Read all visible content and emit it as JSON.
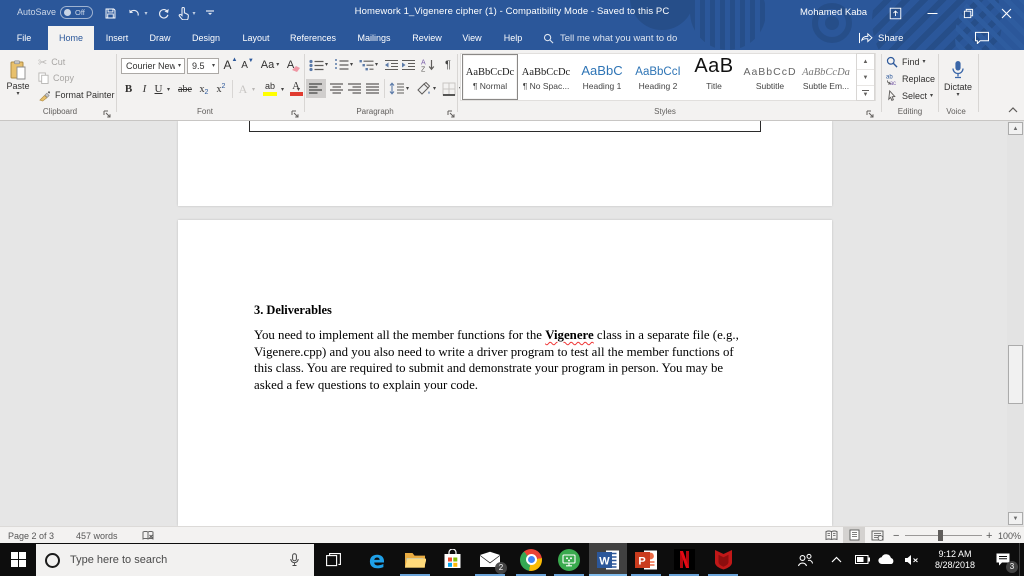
{
  "titlebar": {
    "autosave_label": "AutoSave",
    "autosave_state": "Off",
    "title": "Homework 1_Vigenere cipher (1)  -  Compatibility Mode  -  Saved to this PC",
    "account_name": "Mohamed Kaba"
  },
  "tabs": {
    "items": [
      {
        "label": "File"
      },
      {
        "label": "Home"
      },
      {
        "label": "Insert"
      },
      {
        "label": "Draw"
      },
      {
        "label": "Design"
      },
      {
        "label": "Layout"
      },
      {
        "label": "References"
      },
      {
        "label": "Mailings"
      },
      {
        "label": "Review"
      },
      {
        "label": "View"
      },
      {
        "label": "Help"
      }
    ],
    "active": "Home",
    "tellme": "Tell me what you want to do",
    "share_label": "Share"
  },
  "ribbon": {
    "clipboard": {
      "label": "Clipboard",
      "paste": "Paste",
      "cut": "Cut",
      "copy": "Copy",
      "format_painter": "Format Painter"
    },
    "font": {
      "label": "Font",
      "font_name": "Courier New",
      "font_size": "9.5",
      "bold": "B",
      "italic": "I",
      "underline": "U",
      "strikethrough": "abe",
      "subscript": "x",
      "subscript_mark": "2",
      "superscript": "x",
      "superscript_mark": "2",
      "grow": "A",
      "shrink": "A",
      "change_case": "Aa",
      "clear": "A",
      "effects": "A",
      "highlight": "ab",
      "color": "A"
    },
    "paragraph": {
      "label": "Paragraph",
      "pilcrow": "¶"
    },
    "styles": {
      "label": "Styles",
      "items": [
        {
          "sample": "AaBbCcDc",
          "name": "¶ Normal"
        },
        {
          "sample": "AaBbCcDc",
          "name": "¶ No Spac..."
        },
        {
          "sample": "AaBbC",
          "name": "Heading 1"
        },
        {
          "sample": "AaBbCcI",
          "name": "Heading 2"
        },
        {
          "sample": "AaB",
          "name": "Title"
        },
        {
          "sample": "AaBbCcD",
          "name": "Subtitle"
        },
        {
          "sample": "AaBbCcDa",
          "name": "Subtle Em..."
        }
      ]
    },
    "editing": {
      "label": "Editing",
      "find": "Find",
      "replace": "Replace",
      "select": "Select"
    },
    "voice": {
      "label": "Voice",
      "dictate": "Dictate"
    }
  },
  "document": {
    "heading": "3. Deliverables",
    "para_line1_pre": "You need to implement all the member functions for the ",
    "para_line1_bold": "Vigenere",
    "para_line1_post": " class in a separate file (e.g.,",
    "para_line2": "Vigenere.cpp) and you also need to write a driver program to test all the member functions of",
    "para_line3": "this class. You are required to submit and demonstrate your program in person. You may be",
    "para_line4": "asked a few questions to explain your code."
  },
  "statusbar": {
    "page_info": "Page 2 of 3",
    "word_count": "457 words",
    "zoom_level": "100%",
    "zoom_out": "−",
    "zoom_in": "+"
  },
  "taskbar": {
    "search_placeholder": "Type here to search",
    "time": "9:12 AM",
    "date": "8/28/2018",
    "mail_badge": "2",
    "action_center_badge": "3"
  }
}
